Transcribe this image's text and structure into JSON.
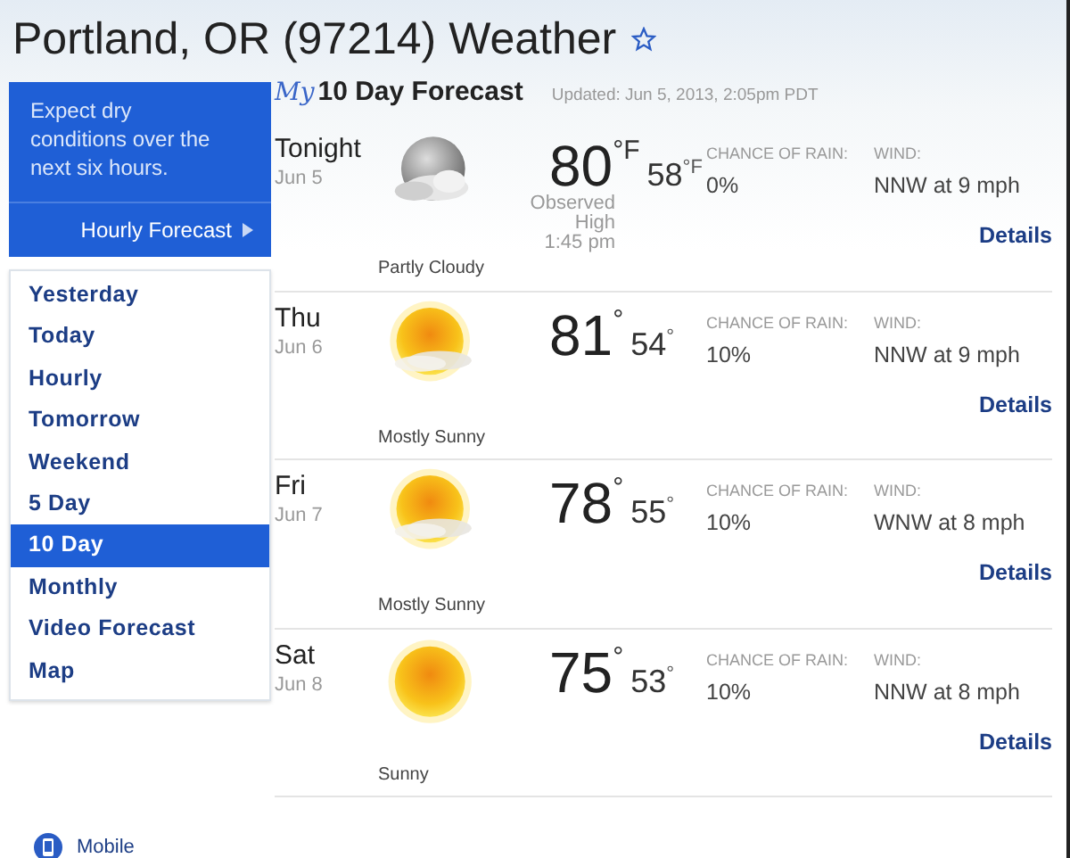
{
  "page_title": "Portland, OR (97214) Weather",
  "favorite": {
    "starred": false
  },
  "alert": {
    "message": "Expect dry conditions over the next six hours.",
    "link": "Hourly Forecast"
  },
  "nav": [
    {
      "label": "Yesterday",
      "selected": false
    },
    {
      "label": "Today",
      "selected": false
    },
    {
      "label": "Hourly",
      "selected": false
    },
    {
      "label": "Tomorrow",
      "selected": false
    },
    {
      "label": "Weekend",
      "selected": false
    },
    {
      "label": "5 Day",
      "selected": false
    },
    {
      "label": "10 Day",
      "selected": true
    },
    {
      "label": "Monthly",
      "selected": false
    },
    {
      "label": "Video Forecast",
      "selected": false
    },
    {
      "label": "Map",
      "selected": false
    }
  ],
  "mobile_link": "Mobile",
  "forecast": {
    "brand": "My",
    "title": "10 Day Forecast",
    "updated": "Updated: Jun 5, 2013, 2:05pm PDT",
    "days": [
      {
        "day": "Tonight",
        "date": "Jun 5",
        "kind": "partly-cloudy",
        "high": "80",
        "high_unit": "°F",
        "low": "58",
        "low_unit": "°F",
        "note_lines": [
          "Observed",
          "High",
          "1:45 pm"
        ],
        "rain_label": "CHANCE OF RAIN:",
        "rain": "0%",
        "wind_label": "WIND:",
        "wind": "NNW at 9 mph",
        "details": "Details",
        "condition": "Partly Cloudy"
      },
      {
        "day": "Thu",
        "date": "Jun 6",
        "kind": "mostly-sunny",
        "high": "81",
        "high_unit": "°",
        "low": "54",
        "low_unit": "°",
        "rain_label": "CHANCE OF RAIN:",
        "rain": "10%",
        "wind_label": "WIND:",
        "wind": "NNW at 9 mph",
        "details": "Details",
        "condition": "Mostly Sunny"
      },
      {
        "day": "Fri",
        "date": "Jun 7",
        "kind": "mostly-sunny",
        "high": "78",
        "high_unit": "°",
        "low": "55",
        "low_unit": "°",
        "rain_label": "CHANCE OF RAIN:",
        "rain": "10%",
        "wind_label": "WIND:",
        "wind": "WNW at 8 mph",
        "details": "Details",
        "condition": "Mostly Sunny"
      },
      {
        "day": "Sat",
        "date": "Jun 8",
        "kind": "sunny",
        "high": "75",
        "high_unit": "°",
        "low": "53",
        "low_unit": "°",
        "rain_label": "CHANCE OF RAIN:",
        "rain": "10%",
        "wind_label": "WIND:",
        "wind": "NNW at 8 mph",
        "details": "Details",
        "condition": "Sunny"
      }
    ]
  }
}
